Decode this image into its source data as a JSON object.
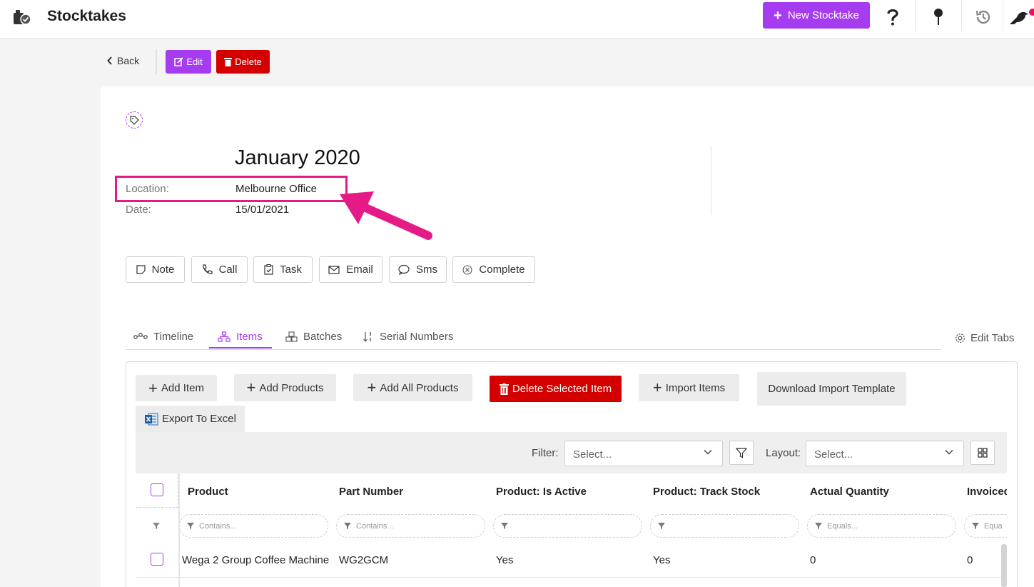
{
  "app": {
    "title": "Stocktakes",
    "new_button": "New Stocktake"
  },
  "actions": {
    "back": "Back",
    "edit": "Edit",
    "delete": "Delete"
  },
  "record": {
    "title": "January 2020",
    "fields": [
      {
        "label": "Location:",
        "value": "Melbourne Office"
      },
      {
        "label": "Date:",
        "value": "15/01/2021"
      }
    ]
  },
  "activity_buttons": [
    "Note",
    "Call",
    "Task",
    "Email",
    "Sms",
    "Complete"
  ],
  "tabs": {
    "items": [
      "Timeline",
      "Items",
      "Batches",
      "Serial Numbers"
    ],
    "active": "Items",
    "edit_tabs": "Edit Tabs"
  },
  "toolbar": {
    "add_item": "Add Item",
    "add_products": "Add Products",
    "add_all_products": "Add All Products",
    "delete_selected": "Delete Selected Item",
    "import_items": "Import Items",
    "download_template": "Download Import Template",
    "export_excel": "Export To Excel"
  },
  "filters": {
    "filter_label": "Filter:",
    "filter_placeholder": "Select...",
    "layout_label": "Layout:",
    "layout_placeholder": "Select..."
  },
  "grid": {
    "columns": [
      "Product",
      "Part Number",
      "Product: Is Active",
      "Product: Track Stock",
      "Actual Quantity",
      "Invoiced"
    ],
    "filter_placeholders": [
      "Contains...",
      "Contains...",
      "",
      "",
      "Equals...",
      "Equa"
    ],
    "rows": [
      [
        "Wega 2 Group Coffee Machine",
        "WG2GCM",
        "Yes",
        "Yes",
        "0",
        "0"
      ]
    ]
  },
  "colors": {
    "accent": "#a53cf0",
    "danger": "#d40000",
    "highlight": "#e51a86"
  }
}
